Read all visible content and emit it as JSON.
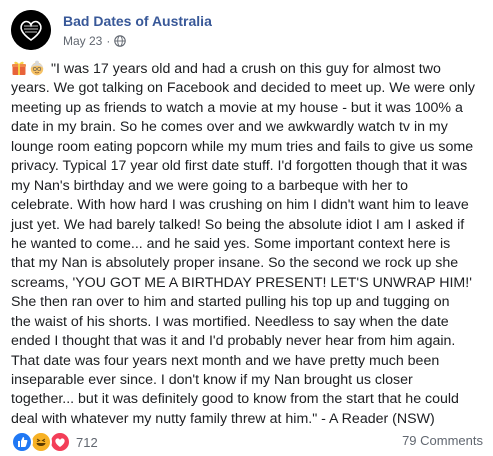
{
  "post": {
    "page_name": "Bad Dates of Australia",
    "date": "May 23",
    "separator": "·",
    "avatar_text": "Bad Dates of Australia",
    "body_lines": [
      "\"I was 17 years old and had a crush on this guy for almost two",
      "years. We got talking on Facebook and decided to meet up. We were only",
      "meeting up as friends to watch a movie at my house - but it was 100% a",
      "date in my brain. So he comes over and we awkwardly watch tv in my",
      "lounge room eating popcorn while my mum tries and fails to give us some",
      "privacy. Typical 17 year old first date stuff. I'd forgotten though that it was",
      "my Nan's birthday and we were going to a barbeque with her to",
      "celebrate. With how hard I was crushing on him I didn't want him to leave",
      "just yet. We had barely talked! So being the absolute idiot I am I asked if",
      "he wanted to come... and he said yes. Some important context here is",
      "that my Nan is absolutely proper insane. So the second we rock up she",
      "screams, 'YOU GOT ME A BIRTHDAY PRESENT! LET'S UNWRAP HIM!'",
      "She then ran over to him and started pulling his top up and tugging on",
      "the waist of his shorts. I was mortified. Needless to say when the date",
      "ended I thought that was it and I'd probably never hear from him again.",
      "That date was four years next month and we have pretty much been",
      "inseparable ever since. I don't know if my Nan brought us closer",
      "together... but it was definitely good to know from the start that he could",
      "deal with whatever my nutty family threw at him.\" - A Reader (NSW)"
    ],
    "emojis": [
      "gift-icon",
      "grandma-face-icon"
    ],
    "reaction_icons": [
      "like-reaction-icon",
      "haha-reaction-icon",
      "love-reaction-icon"
    ],
    "reaction_count": "712",
    "comments": "79 Comments"
  },
  "colors": {
    "link": "#385898",
    "meta": "#616770",
    "text": "#1c1e21",
    "like": "#2078f4",
    "haha": "#f7b125",
    "love": "#f33e58"
  }
}
